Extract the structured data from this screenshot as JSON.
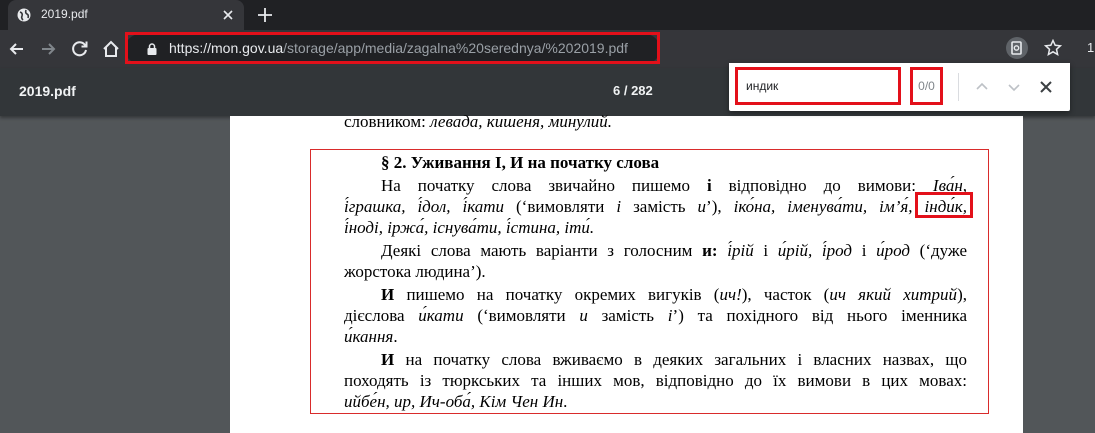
{
  "tab": {
    "title": "2019.pdf"
  },
  "omnibox": {
    "host": "https://mon.gov.ua",
    "path": "/storage/app/media/zagalna%20serednya/%202019.pdf"
  },
  "toolbar": {
    "menu_partial": "1"
  },
  "pdf": {
    "title": "2019.pdf",
    "page_indicator": "6 / 282"
  },
  "find": {
    "query": "индик",
    "count": "0/0"
  },
  "icons": {
    "colors": {
      "highlight": "#e3101a",
      "chrome_dark": "#202124",
      "chrome": "#35363a",
      "pdf_toolbar": "#323639"
    }
  },
  "document": {
    "top_line_prefix": "словником: ",
    "top_line_italic": "левада, кишеня, минулий.",
    "heading": "§ 2. Уживання І, И на початку слова",
    "p1_l1_a": "На початку слова звичайно пишемо ",
    "p1_l1_b": "і",
    "p1_l1_c": " відповідно до вимови: ",
    "p1_l1_d": "Іва́н,",
    "p1_l2_a": "і́грашка, і́дол, і́кати",
    "p1_l2_b": " (‘вимовляти ",
    "p1_l2_c": "і",
    "p1_l2_d": " замість ",
    "p1_l2_e": "и",
    "p1_l2_f": "’), ",
    "p1_l2_g": "іко́на, іменува́ти, ім’я́, ",
    "p1_l2_hit": "інди́к,",
    "p1_l3": "і́ноді, іржа́, існува́ти, і́стина, іти́.",
    "p2_l1_a": "Деякі слова мають варіанти з голосним ",
    "p2_l1_b": "и:",
    "p2_l1_c": " і́рій",
    "p2_l1_d": " і ",
    "p2_l1_e": "и́рій, і́род",
    "p2_l1_f": " і ",
    "p2_l1_g": "и́род",
    "p2_l1_h": " (‘дуже",
    "p2_l2": "жорстока людина’).",
    "p3_l1_a": "И",
    "p3_l1_b": " пишемо на початку окремих вигуків (",
    "p3_l1_c": "ич!",
    "p3_l1_d": "), часток (",
    "p3_l1_e": "ич який хитрий",
    "p3_l1_f": "),",
    "p3_l2_a": "дієслова ",
    "p3_l2_b": "и́кати",
    "p3_l2_c": " (‘вимовляти ",
    "p3_l2_d": "и",
    "p3_l2_e": " замість ",
    "p3_l2_f": "і",
    "p3_l2_g": "’) та похідного від нього іменника",
    "p3_l3_a": "и́кання",
    "p3_l3_b": ".",
    "p4_l1_a": "И",
    "p4_l1_b": " на початку слова вживаємо в деяких загальних і власних назвах, що",
    "p4_l2": "походять із тюркських та інших мов, відповідно до їх вимови в цих мовах:",
    "p4_l3_a": "ийбе́н, ир, Ич-оба́, Кім Чен Ин",
    "p4_l3_b": "."
  }
}
